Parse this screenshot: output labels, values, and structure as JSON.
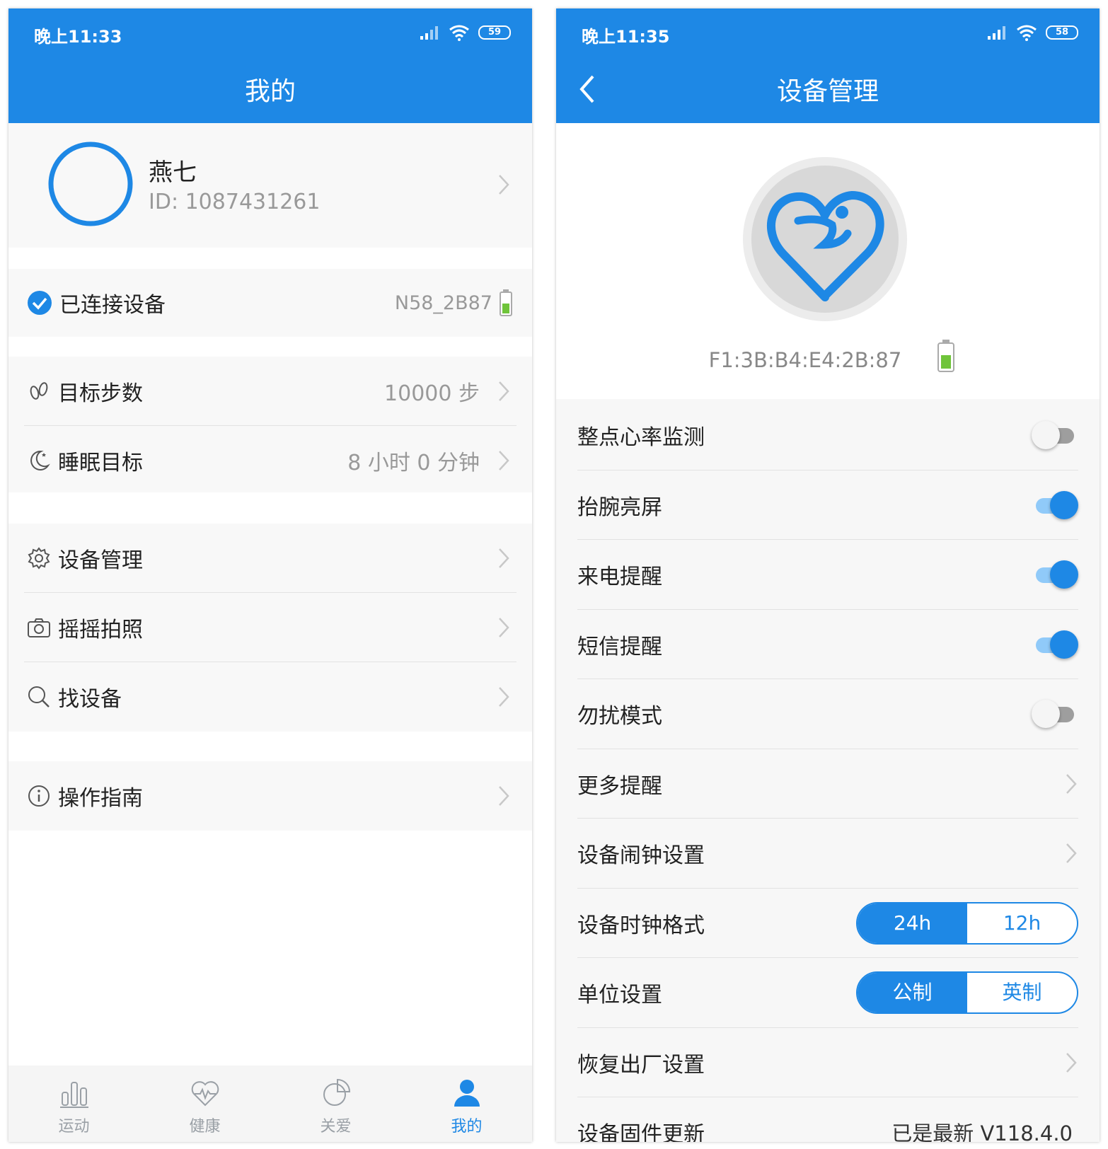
{
  "left": {
    "status_time": "晚上11:33",
    "battery": "59",
    "title": "我的",
    "profile": {
      "name": "燕七",
      "id": "ID: 1087431261"
    },
    "connected": {
      "label": "已连接设备",
      "device": "N58_2B87"
    },
    "goals": [
      {
        "label": "目标步数",
        "value": "10000 步",
        "icon": "footprints-icon"
      },
      {
        "label": "睡眠目标",
        "value": "8 小时 0 分钟",
        "icon": "moon-icon"
      }
    ],
    "tools": [
      {
        "label": "设备管理",
        "icon": "gear-icon"
      },
      {
        "label": "摇摇拍照",
        "icon": "camera-icon"
      },
      {
        "label": "找设备",
        "icon": "search-icon"
      }
    ],
    "guide": {
      "label": "操作指南",
      "icon": "info-icon"
    },
    "tabs": [
      {
        "label": "运动",
        "icon": "bar-chart-icon",
        "active": false
      },
      {
        "label": "健康",
        "icon": "heart-pulse-icon",
        "active": false
      },
      {
        "label": "关爱",
        "icon": "pie-chart-icon",
        "active": false
      },
      {
        "label": "我的",
        "icon": "person-icon",
        "active": true
      }
    ],
    "colors": {
      "primary": "#1e88e5",
      "battery_green": "#6fc43a"
    }
  },
  "right": {
    "status_time": "晚上11:35",
    "battery": "58",
    "title": "设备管理",
    "mac": "F1:3B:B4:E4:2B:87",
    "settings": [
      {
        "label": "整点心率监测",
        "type": "toggle",
        "on": false
      },
      {
        "label": "抬腕亮屏",
        "type": "toggle",
        "on": true
      },
      {
        "label": "来电提醒",
        "type": "toggle",
        "on": true
      },
      {
        "label": "短信提醒",
        "type": "toggle",
        "on": true
      },
      {
        "label": "勿扰模式",
        "type": "toggle",
        "on": false
      },
      {
        "label": "更多提醒",
        "type": "link"
      },
      {
        "label": "设备闹钟设置",
        "type": "link"
      },
      {
        "label": "设备时钟格式",
        "type": "segment",
        "options": [
          "24h",
          "12h"
        ],
        "selected": 0
      },
      {
        "label": "单位设置",
        "type": "segment",
        "options": [
          "公制",
          "英制"
        ],
        "selected": 0
      },
      {
        "label": "恢复出厂设置",
        "type": "link"
      },
      {
        "label": "设备固件更新",
        "type": "value",
        "value": "已是最新 V118.4.0"
      }
    ]
  }
}
